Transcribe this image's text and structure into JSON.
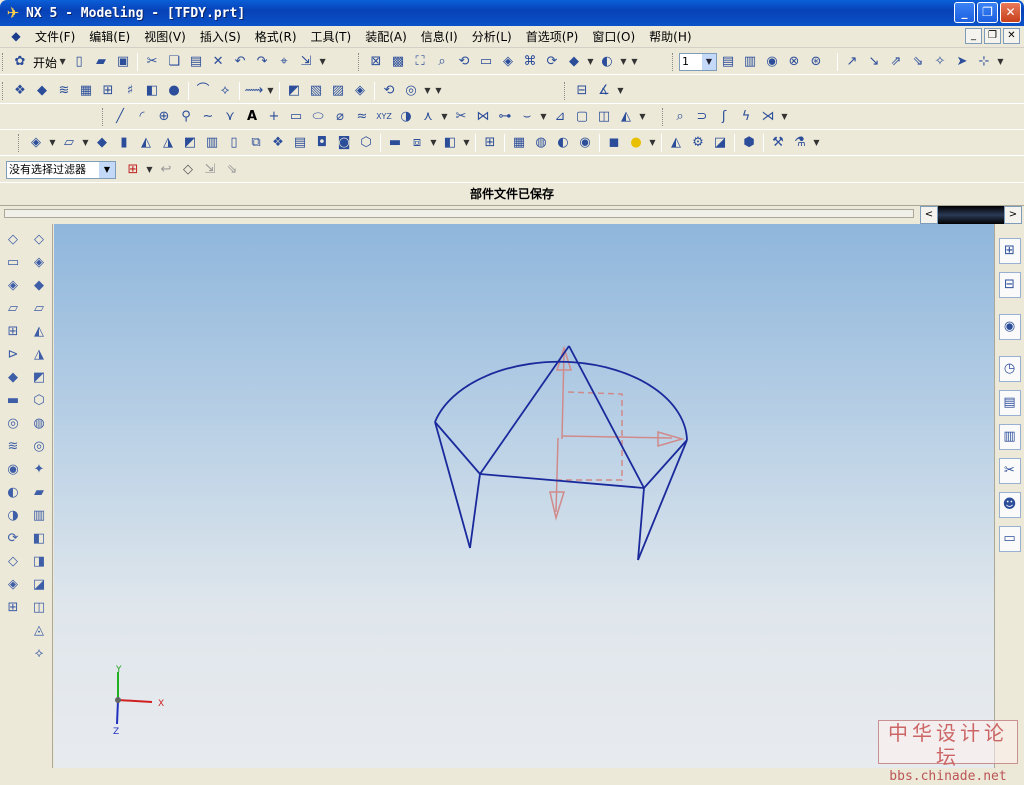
{
  "window": {
    "title": "NX 5 - Modeling - [TFDY.prt]",
    "app_icon": "nx-logo-icon",
    "buttons": [
      "minimize",
      "maximize",
      "close"
    ]
  },
  "menubar": {
    "items": [
      {
        "label": "文件(F)"
      },
      {
        "label": "编辑(E)"
      },
      {
        "label": "视图(V)"
      },
      {
        "label": "插入(S)"
      },
      {
        "label": "格式(R)"
      },
      {
        "label": "工具(T)"
      },
      {
        "label": "装配(A)"
      },
      {
        "label": "信息(I)"
      },
      {
        "label": "分析(L)"
      },
      {
        "label": "首选项(P)"
      },
      {
        "label": "窗口(O)"
      },
      {
        "label": "帮助(H)"
      }
    ]
  },
  "toolbar": {
    "start_label": "开始",
    "layer_value": "1"
  },
  "filter": {
    "value": "没有选择过滤器"
  },
  "status": {
    "message": "部件文件已保存"
  },
  "triad": {
    "x": "X",
    "y": "Y",
    "z": "Z"
  },
  "watermark": {
    "line1": "中华设计论坛",
    "line2": "bbs.chinade.net"
  },
  "colors": {
    "model_edges": "#1a2a9c",
    "csys": "#d08a8a",
    "viewport_top": "#8fb6dc",
    "viewport_bottom": "#e8ebee"
  }
}
